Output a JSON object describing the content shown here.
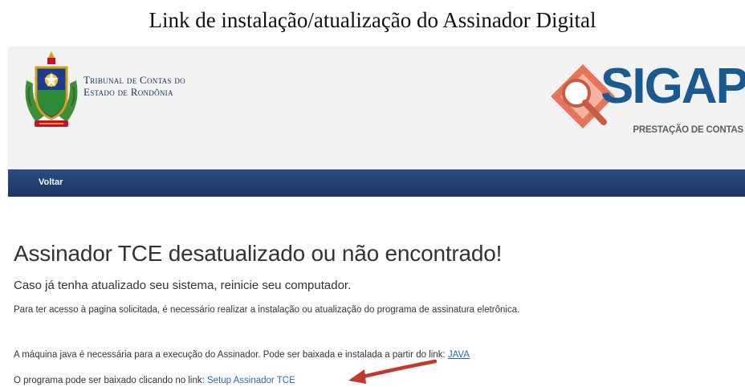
{
  "document_title": "Link de instalação/atualização do Assinador Digital",
  "header": {
    "org_name_line1": "Tribunal de Contas do",
    "org_name_line2": "Estado de Rondônia",
    "logo_icon": "tce-ro-crest-icon",
    "brand_logo": {
      "word": "SIGAP",
      "subtitle": "PRESTAÇÃO DE CONTAS",
      "icon": "magnifier-icon",
      "brand_color": "#1a5a90",
      "accent_color": "#e4745a"
    }
  },
  "nav": {
    "back_label": "Voltar",
    "bar_color": "#233f75"
  },
  "main": {
    "heading": "Assinador TCE desatualizado ou não encontrado!",
    "subheading": "Caso já tenha atualizado seu sistema, reinicie seu computador.",
    "instruction": "Para ter acesso à pagina solicitada, é necessário realizar a instalação ou atualização do programa de assinatura eletrônica.",
    "java_text": "A máquina java é necessária para a execução do Assinador. Pode ser baixada e instalada a partir do link:",
    "java_link": "JAVA",
    "setup_text": "O programa pode ser baixado clicando no link:",
    "setup_link": "Setup Assinador TCE",
    "annotation_arrow_color": "#c0392b"
  }
}
